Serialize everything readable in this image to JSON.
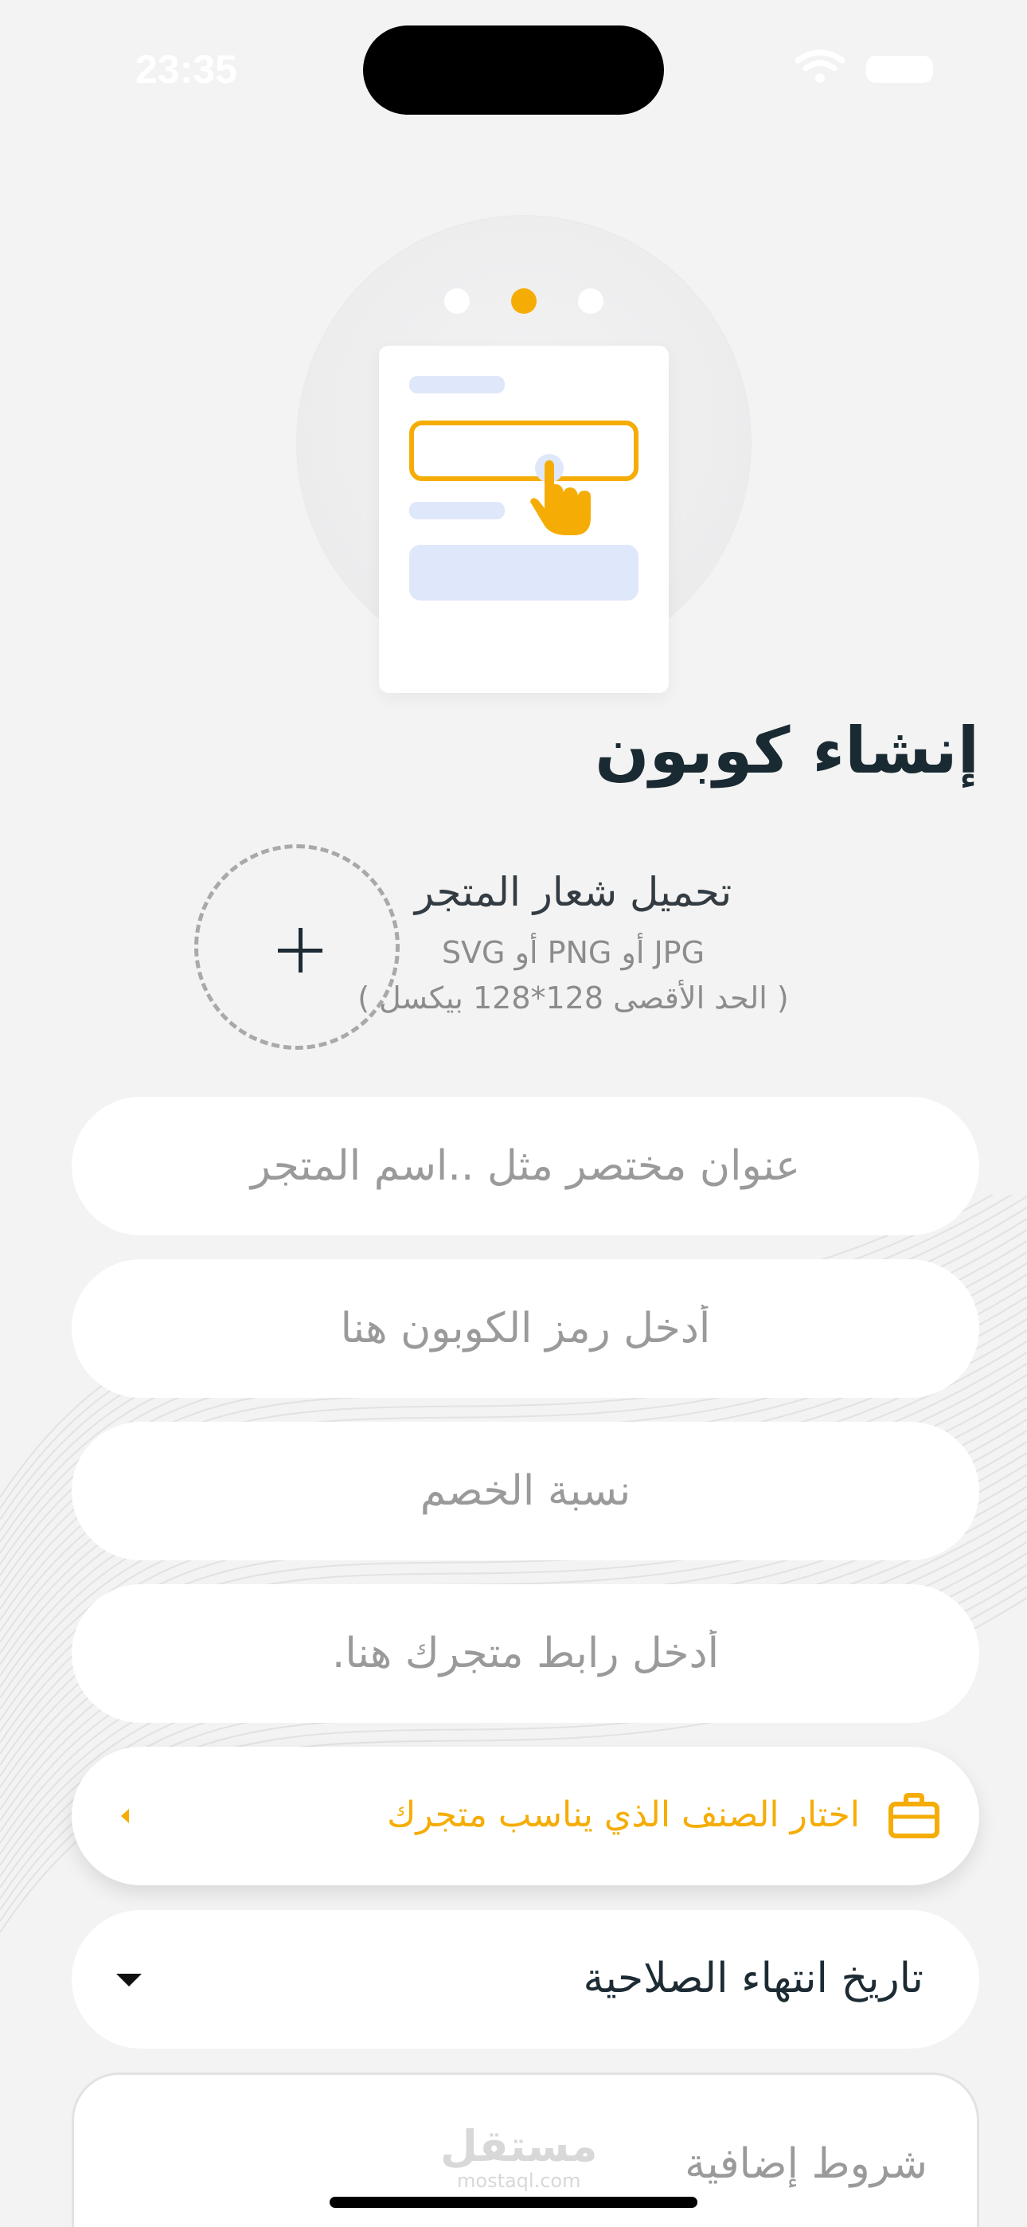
{
  "status_bar": {
    "time": "23:35"
  },
  "onboarding": {
    "active_step": 2,
    "total_steps": 3
  },
  "page": {
    "title": "إنشاء كوبون"
  },
  "logo_upload": {
    "title": "تحميل شعار المتجر",
    "formats": "SVG أو PNG أو JPG",
    "size_hint": "( الحد الأقصى 128*128 بيكسل )"
  },
  "form": {
    "store_name_placeholder": "عنوان مختصر مثل ..اسم المتجر",
    "coupon_code_placeholder": "أدخل رمز الكوبون هنا",
    "discount_placeholder": "نسبة الخصم",
    "store_link_placeholder": "أدخل رابط متجرك هنا.",
    "category_label": "اختار الصنف الذي يناسب متجرك",
    "expiry_label": "تاريخ انتهاء الصلاحية",
    "terms_label": "شروط إضافية"
  },
  "watermark": {
    "arabic": "مستقل",
    "latin": "mostaql.com"
  },
  "colors": {
    "accent": "#f5ad06",
    "background": "#f3f3f3",
    "title": "#1a2a33"
  },
  "icons": {
    "upload": "plus-icon",
    "category": "briefcase-icon",
    "category_chevron": "chevron-left-icon",
    "expiry_caret": "caret-down-icon"
  }
}
